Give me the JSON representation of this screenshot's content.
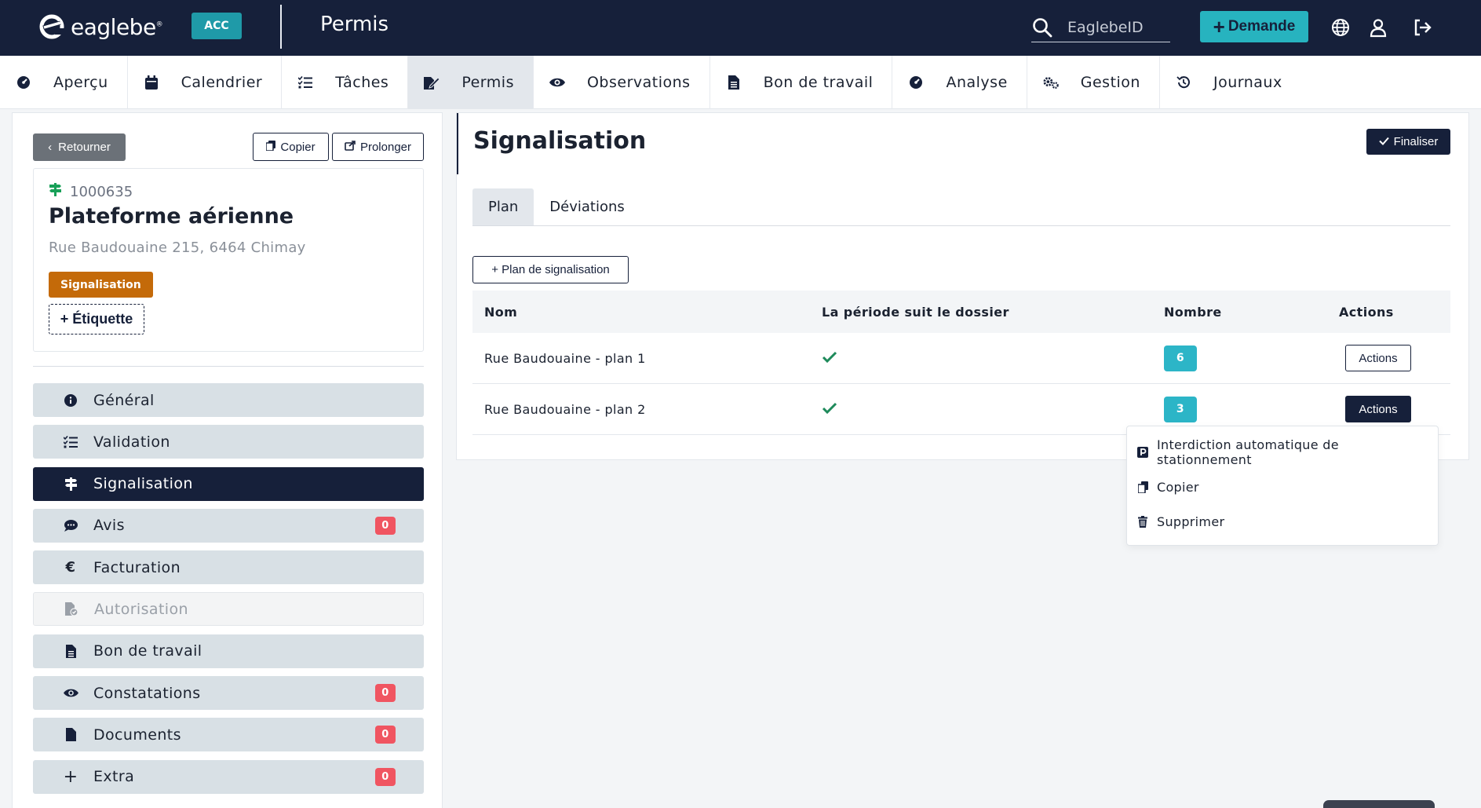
{
  "app": {
    "logo_text": "eaglebe",
    "logo_mark": "®",
    "env_badge": "ACC",
    "page_title": "Permis",
    "search_value": "EaglebeID",
    "demande_label": "Demande"
  },
  "nav": [
    {
      "label": "Aperçu",
      "icon": "dashboard-icon"
    },
    {
      "label": "Calendrier",
      "icon": "calendar-icon"
    },
    {
      "label": "Tâches",
      "icon": "tasks-icon"
    },
    {
      "label": "Permis",
      "icon": "permit-icon",
      "active": true
    },
    {
      "label": "Observations",
      "icon": "eye-icon"
    },
    {
      "label": "Bon de travail",
      "icon": "document-icon"
    },
    {
      "label": "Analyse",
      "icon": "dashboard-icon"
    },
    {
      "label": "Gestion",
      "icon": "gears-icon"
    },
    {
      "label": "Journaux",
      "icon": "history-icon"
    }
  ],
  "sidebar": {
    "back_label": "Retourner",
    "copy_label": "Copier",
    "extend_label": "Prolonger",
    "permit": {
      "id": "1000635",
      "name": "Plateforme aérienne",
      "address": "Rue Baudouaine 215, 6464 Chimay",
      "tag": "Signalisation",
      "add_tag_label": "+ Étiquette"
    },
    "menu": [
      {
        "label": "Général",
        "icon": "info-icon"
      },
      {
        "label": "Validation",
        "icon": "checklist-icon"
      },
      {
        "label": "Signalisation",
        "icon": "signpost-icon",
        "active": true
      },
      {
        "label": "Avis",
        "icon": "comment-icon",
        "count": "0"
      },
      {
        "label": "Facturation",
        "icon": "euro-icon"
      },
      {
        "label": "Autorisation",
        "icon": "file-check-icon",
        "disabled": true
      },
      {
        "label": "Bon de travail",
        "icon": "document-icon"
      },
      {
        "label": "Constatations",
        "icon": "eye-icon",
        "count": "0"
      },
      {
        "label": "Documents",
        "icon": "file-icon",
        "count": "0"
      },
      {
        "label": "Extra",
        "icon": "plus-icon",
        "count": "0"
      }
    ]
  },
  "main": {
    "title": "Signalisation",
    "finalize_label": "Finaliser",
    "tabs": [
      {
        "label": "Plan",
        "active": true
      },
      {
        "label": "Déviations"
      }
    ],
    "add_plan_label": "+ Plan de signalisation",
    "table": {
      "headers": {
        "nom": "Nom",
        "periode": "La période suit le dossier",
        "nombre": "Nombre",
        "actions": "Actions"
      },
      "rows": [
        {
          "nom": "Rue Baudouaine - plan 1",
          "periode": true,
          "nombre": "6",
          "actions": "Actions"
        },
        {
          "nom": "Rue Baudouaine - plan 2",
          "periode": true,
          "nombre": "3",
          "actions": "Actions",
          "open": true
        }
      ]
    },
    "dropdown": [
      {
        "label": "Interdiction automatique de stationnement",
        "icon": "parking-icon"
      },
      {
        "label": "Copier",
        "icon": "copy-icon"
      },
      {
        "label": "Supprimer",
        "icon": "trash-icon"
      }
    ]
  },
  "colors": {
    "navy": "#16203a",
    "teal": "#27b3bf",
    "tag_orange": "#c46a09",
    "count_red": "#f05561",
    "check_green": "#1e8a5b"
  }
}
